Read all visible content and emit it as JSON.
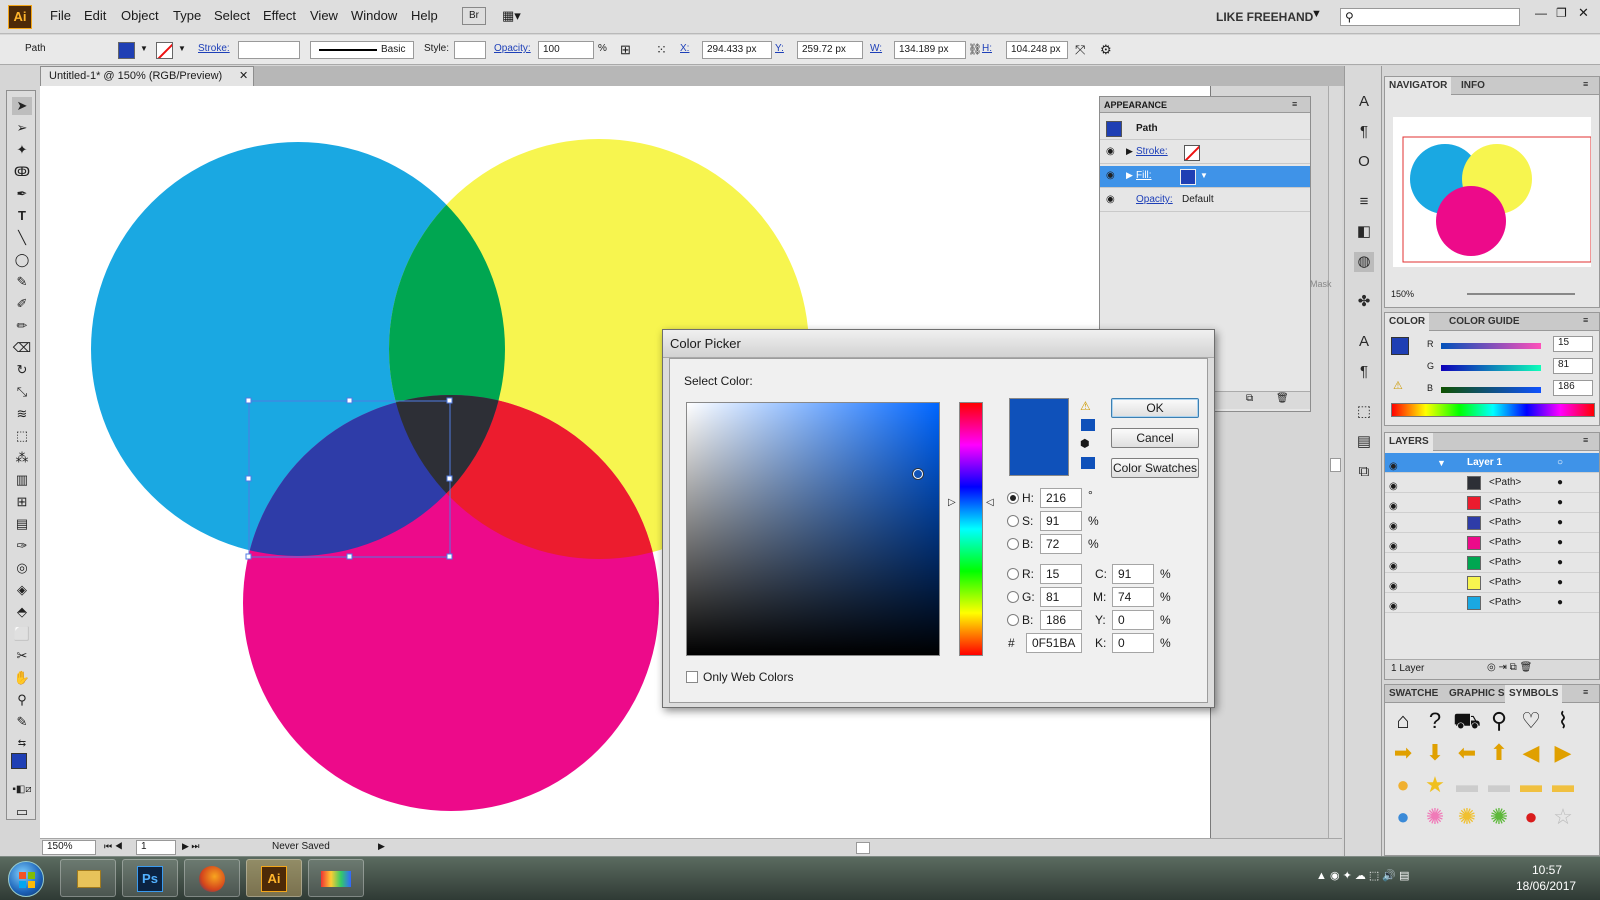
{
  "app": {
    "logo": "Ai",
    "workspace": "LIKE FREEHAND",
    "search_placeholder": "",
    "icons": [
      "bridge-icon",
      "arrange-documents-icon",
      "search-icon"
    ]
  },
  "menu": [
    "File",
    "Edit",
    "Object",
    "Type",
    "Select",
    "Effect",
    "View",
    "Window",
    "Help"
  ],
  "control": {
    "selection": "Path",
    "stroke_label": "Stroke:",
    "brush": "Basic",
    "style_label": "Style:",
    "opacity_label": "Opacity:",
    "opacity": "100",
    "opacity_unit": "%",
    "x_label": "X:",
    "x": "294.433 px",
    "y_label": "Y:",
    "y": "259.72 px",
    "w_label": "W:",
    "w": "134.189 px",
    "h_label": "H:",
    "h": "104.248 px"
  },
  "document": {
    "tab": "Untitled-1* @ 150% (RGB/Preview)",
    "zoom": "150%",
    "page": "1",
    "status": "Never Saved"
  },
  "canvas": {
    "circles": [
      {
        "name": "cyan",
        "color": "#1aa8e2"
      },
      {
        "name": "yellow",
        "color": "#f7f54f"
      },
      {
        "name": "magenta",
        "color": "#ed0a8a"
      }
    ],
    "overlaps": {
      "cyan_yellow": "#00a651",
      "yellow_magenta": "#ec1c2e",
      "cyan_magenta": "#2e3ca8",
      "center": "#2d2f36"
    }
  },
  "appearance": {
    "title": "APPEARANCE",
    "object": "Path",
    "stroke": "Stroke:",
    "fill": "Fill:",
    "opacity": "Opacity:",
    "opacity_value": "Default",
    "mask": "Mask",
    "fill_color": "#1f3fb4"
  },
  "color_picker": {
    "title": "Color Picker",
    "select_label": "Select Color:",
    "ok": "OK",
    "cancel": "Cancel",
    "swatches": "Color Swatches",
    "h_label": "H:",
    "h": "216",
    "h_unit": "°",
    "s_label": "S:",
    "s": "91",
    "s_unit": "%",
    "b_label": "B:",
    "b": "72",
    "b_unit": "%",
    "r_label": "R:",
    "r": "15",
    "g_label": "G:",
    "g": "81",
    "bl_label": "B:",
    "bl": "186",
    "hex_label": "#",
    "hex": "0F51BA",
    "c_label": "C:",
    "c": "91",
    "m_label": "M:",
    "m": "74",
    "y_label": "Y:",
    "yv": "0",
    "k_label": "K:",
    "k": "0",
    "pct": "%",
    "web_only": "Only Web Colors",
    "color": "#0f51ba",
    "hue_fraction": 0.6,
    "saturation": 0.91,
    "brightness": 0.72
  },
  "navigator": {
    "tabs": [
      "NAVIGATOR",
      "INFO"
    ],
    "zoom": "150%"
  },
  "color_panel": {
    "tabs": [
      "COLOR",
      "COLOR GUIDE"
    ],
    "r_label": "R",
    "r": "15",
    "g_label": "G",
    "g": "81",
    "b_label": "B",
    "b": "186"
  },
  "layers": {
    "title": "LAYERS",
    "layer": "Layer 1",
    "items": [
      "<Path>",
      "<Path>",
      "<Path>",
      "<Path>",
      "<Path>",
      "<Path>",
      "<Path>"
    ],
    "footer": "1 Layer",
    "thumb_colors": [
      "#2d2f36",
      "#ec1c2e",
      "#2e3ca8",
      "#ed0a8a",
      "#00a651",
      "#f7f54f",
      "#1aa8e2"
    ]
  },
  "symbols": {
    "tabs": [
      "SWATCHE",
      "GRAPHIC S",
      "SYMBOLS"
    ]
  },
  "taskbar": {
    "time": "10:57",
    "date": "18/06/2017",
    "apps": [
      "windows-explorer",
      "photoshop",
      "firefox",
      "illustrator",
      "media-app"
    ],
    "ps": "Ps",
    "ai": "Ai"
  }
}
